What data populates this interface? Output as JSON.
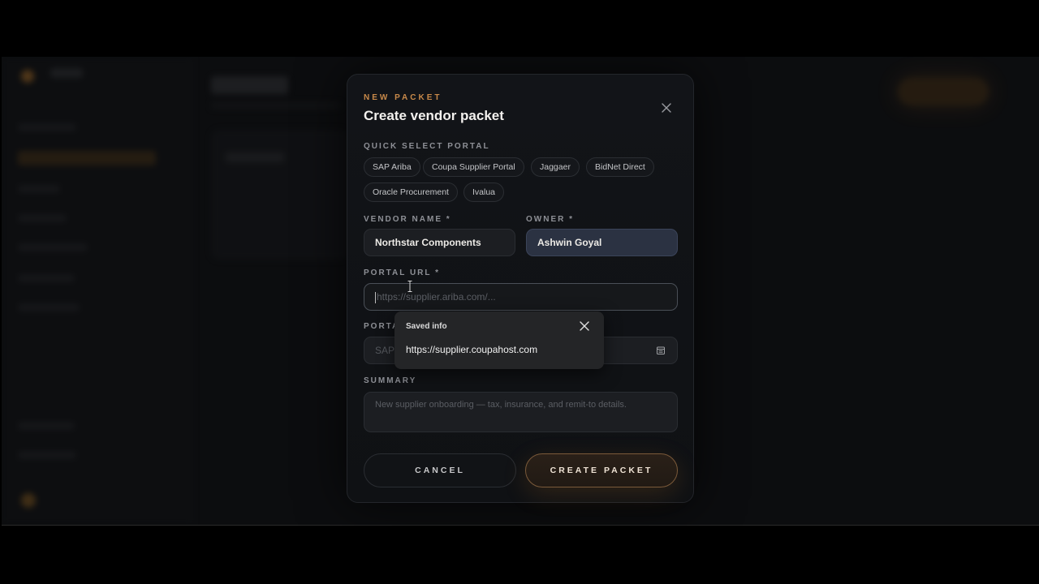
{
  "modal": {
    "eyebrow": "NEW PACKET",
    "title": "Create vendor packet",
    "quick_select_label": "QUICK SELECT PORTAL",
    "portals": [
      "SAP Ariba",
      "Coupa Supplier Portal",
      "Jaggaer",
      "BidNet Direct",
      "Oracle Procurement",
      "Ivalua"
    ],
    "vendor_name_label": "VENDOR NAME *",
    "vendor_name_value": "Northstar Components",
    "owner_label": "OWNER *",
    "owner_value": "Ashwin Goyal",
    "portal_url_label": "PORTAL URL *",
    "portal_url_placeholder": "https://supplier.ariba.com/...",
    "portal_label": "PORTA",
    "portal_value": "SAP",
    "summary_label": "SUMMARY",
    "summary_placeholder": "New supplier onboarding — tax, insurance, and remit-to details.",
    "cancel_label": "CANCEL",
    "create_label": "CREATE PACKET"
  },
  "autofill": {
    "title": "Saved info",
    "suggestion": "https://supplier.coupahost.com"
  },
  "colors": {
    "accent": "#c98a4a",
    "modal_bg": "#121418",
    "owner_field": "#2b3242"
  }
}
